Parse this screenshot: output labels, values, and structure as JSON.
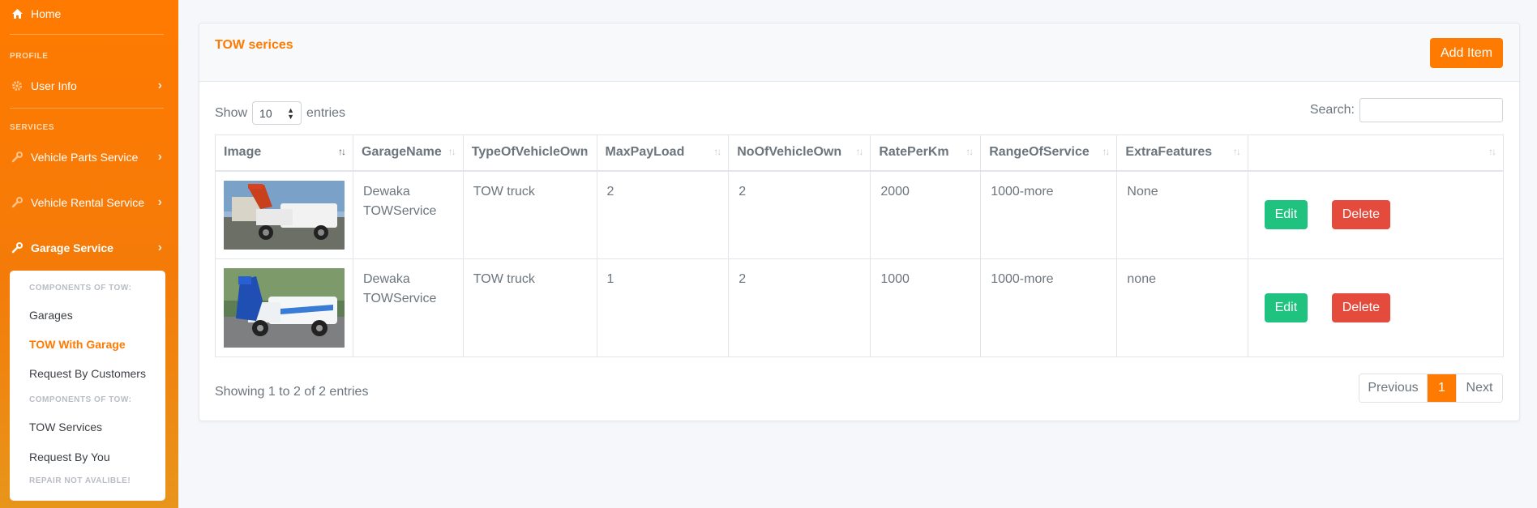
{
  "sidebar": {
    "home": "Home",
    "profile_header": "PROFILE",
    "user_info": "User Info",
    "services_header": "SERVICES",
    "vehicle_parts": "Vehicle Parts Service",
    "vehicle_rental": "Vehicle Rental Service",
    "garage_service": "Garage Service",
    "submenu": {
      "head1": "COMPONENTS OF TOW:",
      "garages": "Garages",
      "tow_with_garage": "TOW With Garage",
      "request_by_customers": "Request By Customers",
      "head2": "COMPONENTS OF TOW:",
      "tow_services": "TOW Services",
      "request_by_you": "Request By You",
      "head3": "REPAIR NOT AVALIBLE!"
    }
  },
  "card": {
    "title": "TOW serices",
    "add_button": "Add Item"
  },
  "controls": {
    "show_label": "Show",
    "length_value": "10",
    "entries_label": "entries",
    "search_label": "Search:"
  },
  "table": {
    "columns": [
      "Image",
      "GarageName",
      "TypeOfVehicleOwn",
      "MaxPayLoad",
      "NoOfVehicleOwn",
      "RatePerKm",
      "RangeOfService",
      "ExtraFeatures",
      ""
    ],
    "rows": [
      {
        "garage_name": "Dewaka TOWService",
        "type": "TOW truck",
        "max_payload": "2",
        "no_of_vehicle": "2",
        "rate": "2000",
        "range": "1000-more",
        "extra": "None",
        "edit": "Edit",
        "delete": "Delete"
      },
      {
        "garage_name": "Dewaka TOWService",
        "type": "TOW truck",
        "max_payload": "1",
        "no_of_vehicle": "2",
        "rate": "1000",
        "range": "1000-more",
        "extra": "none",
        "edit": "Edit",
        "delete": "Delete"
      }
    ]
  },
  "footer": {
    "info": "Showing 1 to 2 of 2 entries",
    "previous": "Previous",
    "page": "1",
    "next": "Next"
  },
  "icons": {
    "home": "home-icon",
    "user_info": "gear-icon",
    "services": "wrench-icon",
    "chevron": "chevron-right-icon"
  },
  "colors": {
    "accent": "#ff7a00",
    "edit": "#20c27f",
    "delete": "#e54b3c"
  }
}
